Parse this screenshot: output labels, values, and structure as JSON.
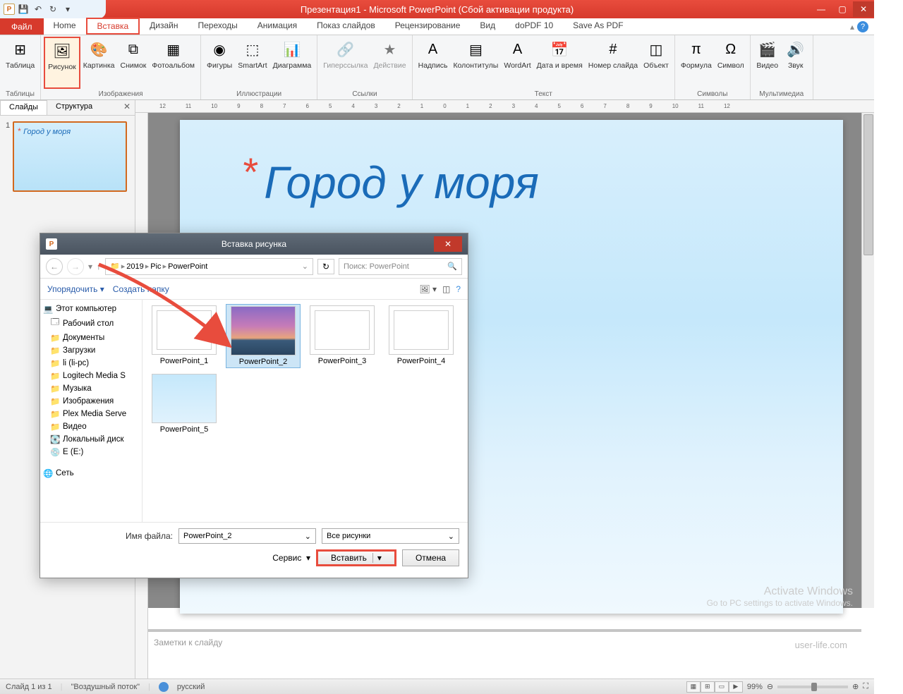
{
  "titlebar": {
    "title": "Презентация1 - Microsoft PowerPoint (Сбой активации продукта)",
    "app_letter": "P"
  },
  "tabs": {
    "file": "Файл",
    "items": [
      "Home",
      "Вставка",
      "Дизайн",
      "Переходы",
      "Анимация",
      "Показ слайдов",
      "Рецензирование",
      "Вид",
      "doPDF 10",
      "Save As PDF"
    ],
    "active_index": 1
  },
  "ribbon": {
    "groups": [
      {
        "label": "Таблицы",
        "items": [
          {
            "label": "Таблица",
            "icon": "⊞"
          }
        ]
      },
      {
        "label": "Изображения",
        "items": [
          {
            "label": "Рисунок",
            "icon": "🖼",
            "highlighted": true
          },
          {
            "label": "Картинка",
            "icon": "🎨"
          },
          {
            "label": "Снимок",
            "icon": "⧉"
          },
          {
            "label": "Фотоальбом",
            "icon": "▦"
          }
        ]
      },
      {
        "label": "Иллюстрации",
        "items": [
          {
            "label": "Фигуры",
            "icon": "◉"
          },
          {
            "label": "SmartArt",
            "icon": "⬚"
          },
          {
            "label": "Диаграмма",
            "icon": "📊"
          }
        ]
      },
      {
        "label": "Ссылки",
        "items": [
          {
            "label": "Гиперссылка",
            "icon": "🔗",
            "disabled": true
          },
          {
            "label": "Действие",
            "icon": "★",
            "disabled": true
          }
        ]
      },
      {
        "label": "Текст",
        "items": [
          {
            "label": "Надпись",
            "icon": "A"
          },
          {
            "label": "Колонтитулы",
            "icon": "▤"
          },
          {
            "label": "WordArt",
            "icon": "A"
          },
          {
            "label": "Дата и\nвремя",
            "icon": "📅"
          },
          {
            "label": "Номер\nслайда",
            "icon": "#"
          },
          {
            "label": "Объект",
            "icon": "◫"
          }
        ]
      },
      {
        "label": "Символы",
        "items": [
          {
            "label": "Формула",
            "icon": "π"
          },
          {
            "label": "Символ",
            "icon": "Ω"
          }
        ]
      },
      {
        "label": "Мультимедиа",
        "items": [
          {
            "label": "Видео",
            "icon": "🎬"
          },
          {
            "label": "Звук",
            "icon": "🔊"
          }
        ]
      }
    ]
  },
  "panel": {
    "tabs": [
      "Слайды",
      "Структура"
    ],
    "thumb_num": "1",
    "thumb_title": "Город у моря",
    "asterisk": "*"
  },
  "slide": {
    "asterisk": "*",
    "title": "Город у моря"
  },
  "notes": {
    "placeholder": "Заметки к слайду"
  },
  "activate": {
    "line1": "Activate Windows",
    "line2": "Go to PC settings to activate Windows."
  },
  "watermark": "user-life.com",
  "status": {
    "slide_count": "Слайд 1 из 1",
    "theme": "\"Воздушный поток\"",
    "language": "русский",
    "zoom": "99%"
  },
  "dialog": {
    "title": "Вставка рисунка",
    "icon": "P",
    "breadcrumbs": [
      "2019",
      "Pic",
      "PowerPoint"
    ],
    "search_placeholder": "Поиск: PowerPoint",
    "toolbar": {
      "organize": "Упорядочить",
      "new_folder": "Создать папку"
    },
    "tree": [
      {
        "label": "Этот компьютер",
        "icon": "💻",
        "root": true
      },
      {
        "label": "Рабочий стол",
        "icon": "🗔"
      },
      {
        "label": "Документы",
        "icon": "📁"
      },
      {
        "label": "Загрузки",
        "icon": "📁"
      },
      {
        "label": "li (li-pc)",
        "icon": "📁"
      },
      {
        "label": "Logitech Media S",
        "icon": "📁"
      },
      {
        "label": "Музыка",
        "icon": "📁"
      },
      {
        "label": "Изображения",
        "icon": "📁"
      },
      {
        "label": "Plex Media Serve",
        "icon": "📁"
      },
      {
        "label": "Видео",
        "icon": "📁"
      },
      {
        "label": "Локальный диск",
        "icon": "💽"
      },
      {
        "label": "E (E:)",
        "icon": "💿"
      },
      {
        "label": "",
        "icon": "",
        "spacer": true
      },
      {
        "label": "Сеть",
        "icon": "🌐",
        "root": true
      }
    ],
    "files": [
      {
        "name": "PowerPoint_1",
        "type": "ppt"
      },
      {
        "name": "PowerPoint_2",
        "type": "sunset",
        "selected": true
      },
      {
        "name": "PowerPoint_3",
        "type": "ppt"
      },
      {
        "name": "PowerPoint_4",
        "type": "ppt"
      },
      {
        "name": "PowerPoint_5",
        "type": "sea"
      }
    ],
    "footer": {
      "name_label": "Имя файла:",
      "name_value": "PowerPoint_2",
      "filter": "Все рисунки",
      "service": "Сервис",
      "insert": "Вставить",
      "cancel": "Отмена"
    }
  },
  "ruler_marks": [
    "12",
    "11",
    "10",
    "9",
    "8",
    "7",
    "6",
    "5",
    "4",
    "3",
    "2",
    "1",
    "0",
    "1",
    "2",
    "3",
    "4",
    "5",
    "6",
    "7",
    "8",
    "9",
    "10",
    "11",
    "12"
  ]
}
